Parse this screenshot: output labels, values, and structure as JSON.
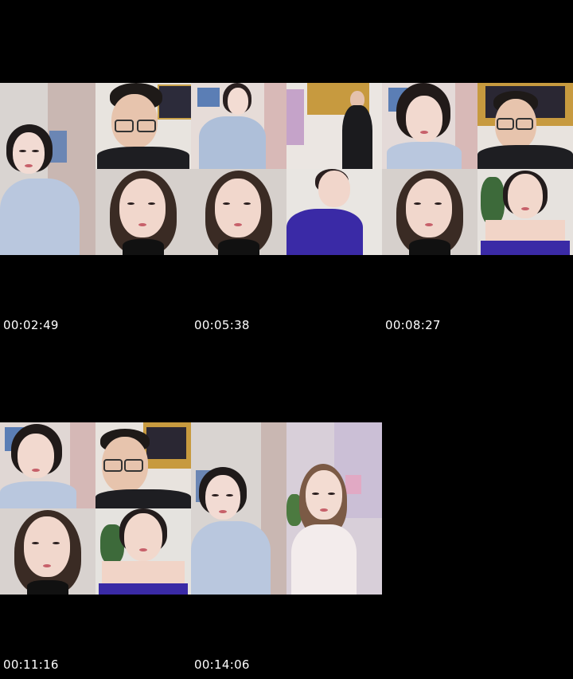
{
  "timestamps": {
    "t1": "00:02:49",
    "t2": "00:05:38",
    "t3": "00:08:27",
    "t4": "00:11:16",
    "t5": "00:14:06"
  },
  "colors": {
    "background": "#000000",
    "timestamp_text": "#ffffff"
  }
}
